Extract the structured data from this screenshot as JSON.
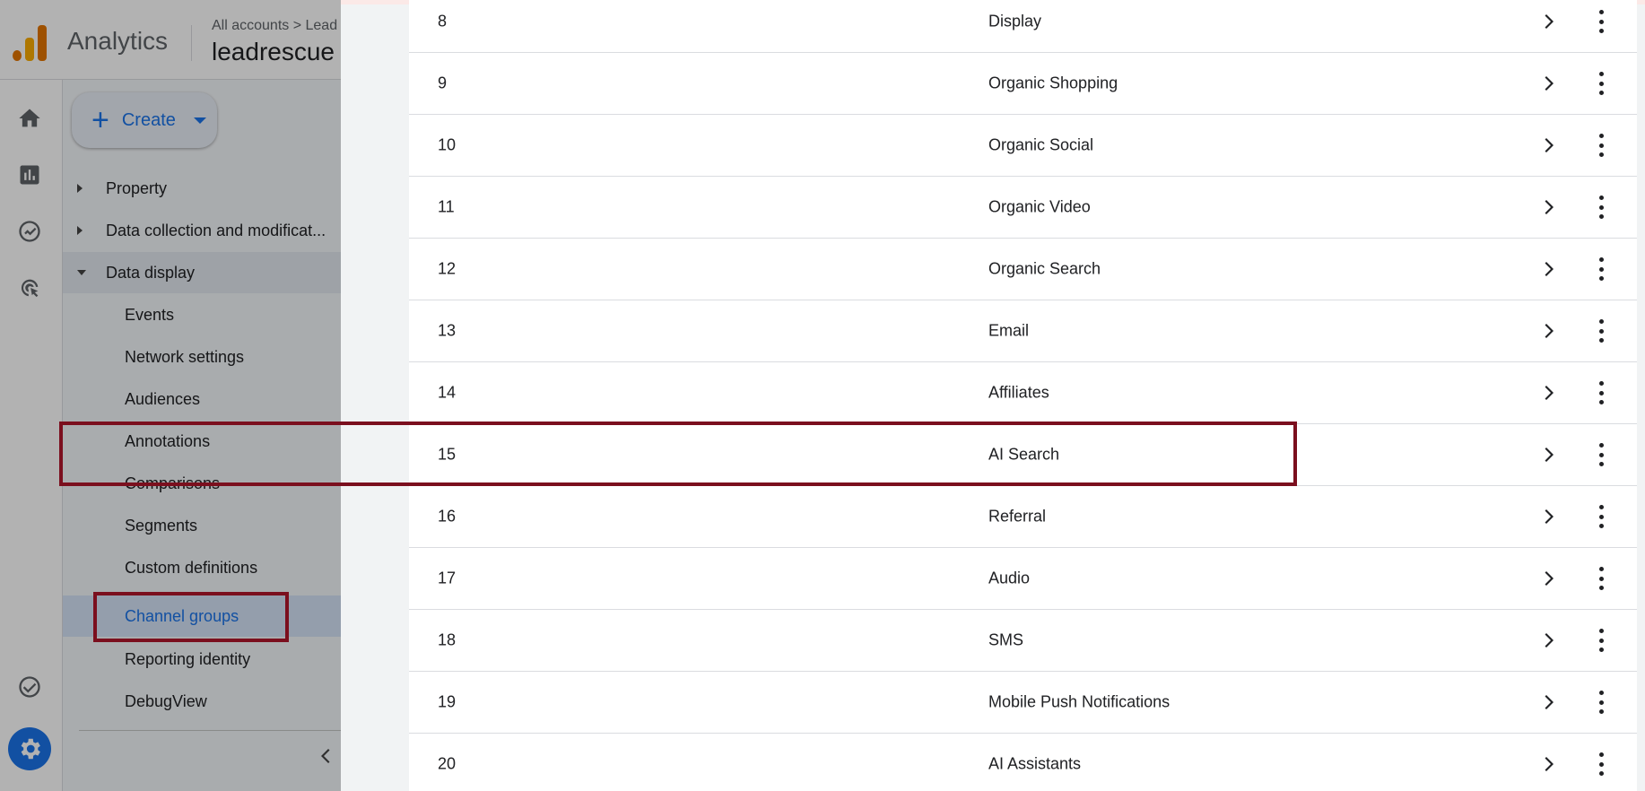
{
  "header": {
    "app_title": "Analytics",
    "breadcrumb": "All accounts > Lead",
    "property_name": "leadrescue"
  },
  "sidebar": {
    "create_label": "Create",
    "create_icon": "plus-icon",
    "sections": [
      {
        "label": "Property",
        "expanded": false
      },
      {
        "label": "Data collection and modificat...",
        "expanded": false
      },
      {
        "label": "Data display",
        "expanded": true
      }
    ],
    "items": [
      {
        "label": "Events"
      },
      {
        "label": "Network settings"
      },
      {
        "label": "Audiences"
      },
      {
        "label": "Annotations"
      },
      {
        "label": "Comparisons"
      },
      {
        "label": "Segments"
      },
      {
        "label": "Custom definitions"
      },
      {
        "label": "Channel groups",
        "active": true
      },
      {
        "label": "Reporting identity"
      },
      {
        "label": "DebugView"
      }
    ]
  },
  "rail": {
    "icons": [
      "home-icon",
      "reports-icon",
      "explore-icon",
      "advertising-icon",
      "check-icon",
      "settings-gear-icon"
    ]
  },
  "channels": {
    "rows": [
      {
        "num": "8",
        "name": "Display"
      },
      {
        "num": "9",
        "name": "Organic Shopping"
      },
      {
        "num": "10",
        "name": "Organic Social"
      },
      {
        "num": "11",
        "name": "Organic Video"
      },
      {
        "num": "12",
        "name": "Organic Search"
      },
      {
        "num": "13",
        "name": "Email"
      },
      {
        "num": "14",
        "name": "Affiliates"
      },
      {
        "num": "15",
        "name": "AI Search",
        "highlighted": true
      },
      {
        "num": "16",
        "name": "Referral"
      },
      {
        "num": "17",
        "name": "Audio"
      },
      {
        "num": "18",
        "name": "SMS"
      },
      {
        "num": "19",
        "name": "Mobile Push Notifications"
      },
      {
        "num": "20",
        "name": "AI Assistants"
      }
    ]
  },
  "colors": {
    "accent": "#1a73e8",
    "highlight_border": "#7b0f1e",
    "logo_orange": "#e37400",
    "logo_yellow": "#f9ab00"
  }
}
